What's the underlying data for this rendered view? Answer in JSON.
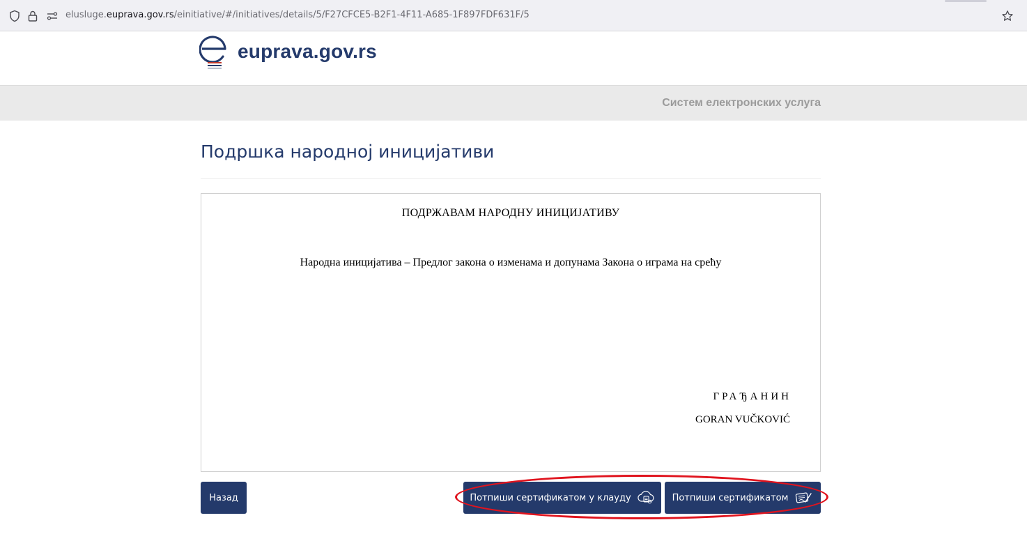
{
  "browser": {
    "url_prefix": "elusluge.",
    "url_host": "euprava.gov.rs",
    "url_path": "/einitiative/#/initiatives/details/5/F27CFCE5-B2F1-4F11-A685-1F897FDF631F/5",
    "icons": [
      "shield-icon",
      "lock-icon",
      "site-permissions-icon",
      "bookmark-star-icon"
    ]
  },
  "header": {
    "logo_text": "euprava.gov.rs",
    "logo_icon": "euprava-logo-icon"
  },
  "banner": {
    "title": "Систем електронских услуга"
  },
  "page": {
    "title": "Подршка народној иницијативи"
  },
  "document": {
    "heading": "ПОДРЖАВАМ НАРОДНУ ИНИЦИЈАТИВУ",
    "body": "Народна иницијатива – Предлог закона о изменама и допунама Закона о играма на срећу",
    "role": "ГРАЂАНИН",
    "name": "GORAN VUČKOVIĆ"
  },
  "actions": {
    "back_label": "Назад",
    "sign_cloud_label": "Потпиши сертификатом у клауду",
    "sign_cert_label": "Потпиши сертификатом",
    "sign_cloud_icon": "cloud-signature-icon",
    "sign_cert_icon": "certificate-signature-icon"
  },
  "colors": {
    "brand": "#243a6b",
    "highlight": "#e0141e",
    "banner_bg": "#eaeaea"
  }
}
